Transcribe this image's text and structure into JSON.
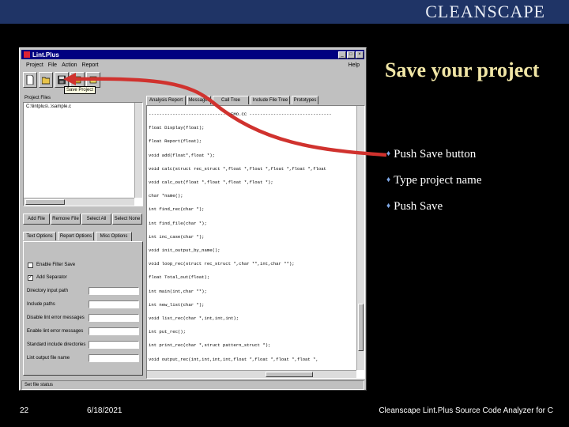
{
  "brand": "CLEANSCAPE",
  "slide": {
    "title": "Save your project",
    "bullets": [
      "Push Save button",
      "Type project name",
      "Push Save"
    ]
  },
  "footer": {
    "slide_number": "22",
    "date": "6/18/2021",
    "caption": "Cleanscape Lint.Plus Source Code Analyzer for C"
  },
  "app": {
    "title": "Lint.Plus",
    "menu": [
      "Project",
      "File",
      "Action",
      "Report"
    ],
    "help": "Help",
    "tooltip": "Save Project",
    "file_list_label": "Project Files",
    "file_list_item": "C:\\lintplus\\..\\sample.c",
    "file_buttons": [
      "Add File",
      "Remove File",
      "Select All",
      "Select None"
    ],
    "option_tabs": [
      "Text Options",
      "Report Options",
      "Misc Options"
    ],
    "checkboxes": [
      {
        "label": "Enable Filter Save",
        "checked": false
      },
      {
        "label": "Add Separator",
        "checked": true
      }
    ],
    "fields": [
      "Directory input path",
      "Include paths",
      "Disable lint error messages",
      "Enable lint error messages",
      "Standard include directories",
      "Lint output file name"
    ],
    "report_tabs": [
      "Analysis Report",
      "Messages",
      "Call Tree",
      "Include File Tree",
      "Prototypes"
    ],
    "code_lines": [
      "----------------------------- DEMO.CC -------------------------------",
      "float Display(float);",
      "float Report(float);",
      "void add(float*,float *);",
      "void calc(struct rec_struct *,float *,float *,float *,float *,float",
      "void calc_out(float *,float *,float *,float *);",
      "char *name();",
      "int find_rec(char *);",
      "int find_file(char *);",
      "int inc_case(char *);",
      "void init_output_by_name();",
      "void loop_rec(struct rec_struct *,char **,int,char **);",
      "float Total_out(float);",
      "int main(int,char **);",
      "int new_list(char *);",
      "void list_rec(char *,int,int,int);",
      "int put_rec();",
      "int print_rec(char *,struct pattern_struct *);",
      "void output_rec(int,int,int,int,float *,float *,float *,float *,"
    ],
    "status": "Set file status"
  }
}
